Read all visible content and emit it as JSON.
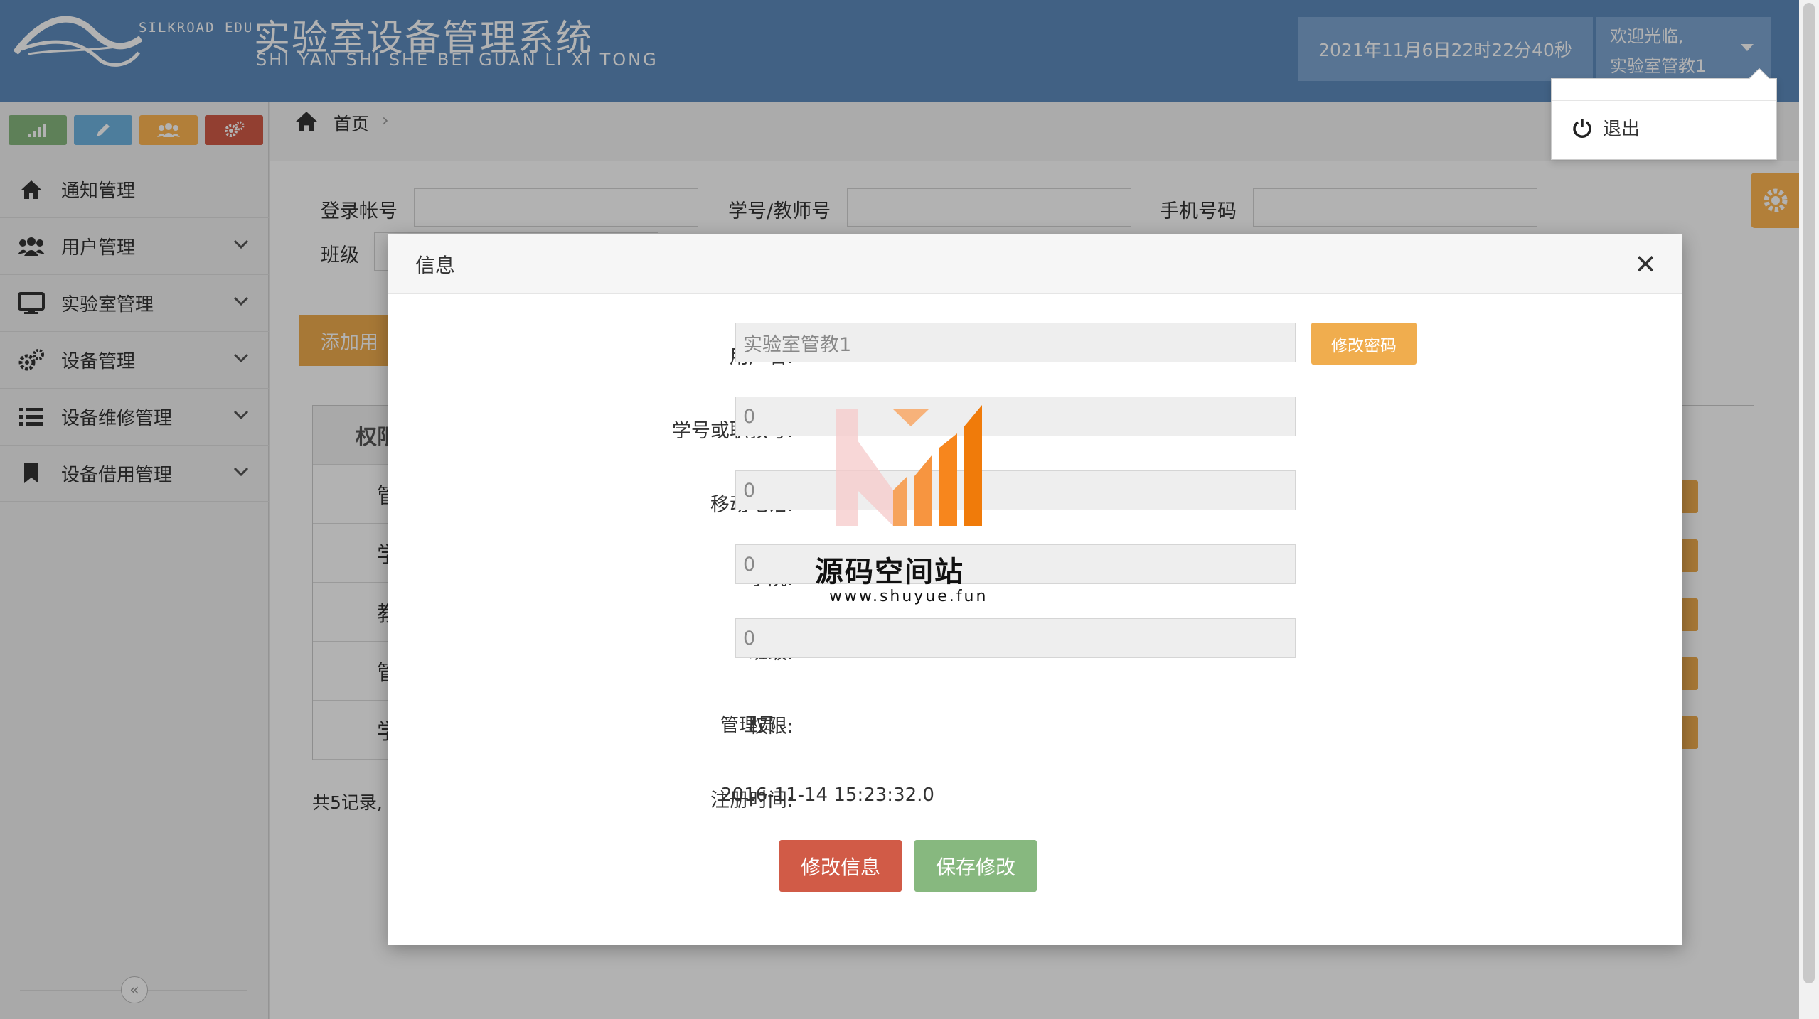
{
  "header": {
    "logo_small": "SILKROAD EDU",
    "title": "实验室设备管理系统",
    "subtitle": "SHI YAN SHI SHE BEI GUAN LI XI TONG",
    "datetime": "2021年11月6日22时22分40秒",
    "welcome": "欢迎光临,",
    "username": "实验室管教1"
  },
  "user_menu": {
    "logout": "退出"
  },
  "sidebar": {
    "items": [
      {
        "label": "通知管理",
        "icon": "home-icon"
      },
      {
        "label": "用户管理",
        "icon": "users-icon"
      },
      {
        "label": "实验室管理",
        "icon": "desktop-icon"
      },
      {
        "label": "设备管理",
        "icon": "gears-icon"
      },
      {
        "label": "设备维修管理",
        "icon": "list-icon"
      },
      {
        "label": "设备借用管理",
        "icon": "bookmark-icon"
      }
    ],
    "collapse": "«"
  },
  "breadcrumb": {
    "home": "首页"
  },
  "search": {
    "login_label": "登录帐号",
    "id_label": "学号/教师号",
    "phone_label": "手机号码",
    "class_label": "班级"
  },
  "content": {
    "add_button": "添加用",
    "table_header": "权限",
    "rows": [
      "管",
      "学",
      "教",
      "管",
      "学"
    ],
    "records": "共5记录,"
  },
  "modal": {
    "title": "信息",
    "close": "✕",
    "username_label": "用户名:",
    "username_value": "实验室管教1",
    "change_password": "修改密码",
    "id_label": "学号或职教号:",
    "id_value": "0",
    "phone_label": "移动电话:",
    "phone_value": "0",
    "college_label": "学院:",
    "college_value": "0",
    "class_label": "班级:",
    "class_value": "0",
    "role_label": "权限:",
    "role_value": "管理员",
    "regtime_label": "注册时间:",
    "regtime_value": "2016-11-14 15:23:32.0",
    "edit_button": "修改信息",
    "save_button": "保存修改"
  },
  "watermark": {
    "name": "源码空间站",
    "url": "www.shuyue.fun"
  },
  "colors": {
    "header_bg": "#5d8bbd",
    "green": "#87b87f",
    "blue": "#6fb3e0",
    "orange": "#ffb752",
    "red": "#d15b47",
    "warning": "#f0ad4e"
  }
}
